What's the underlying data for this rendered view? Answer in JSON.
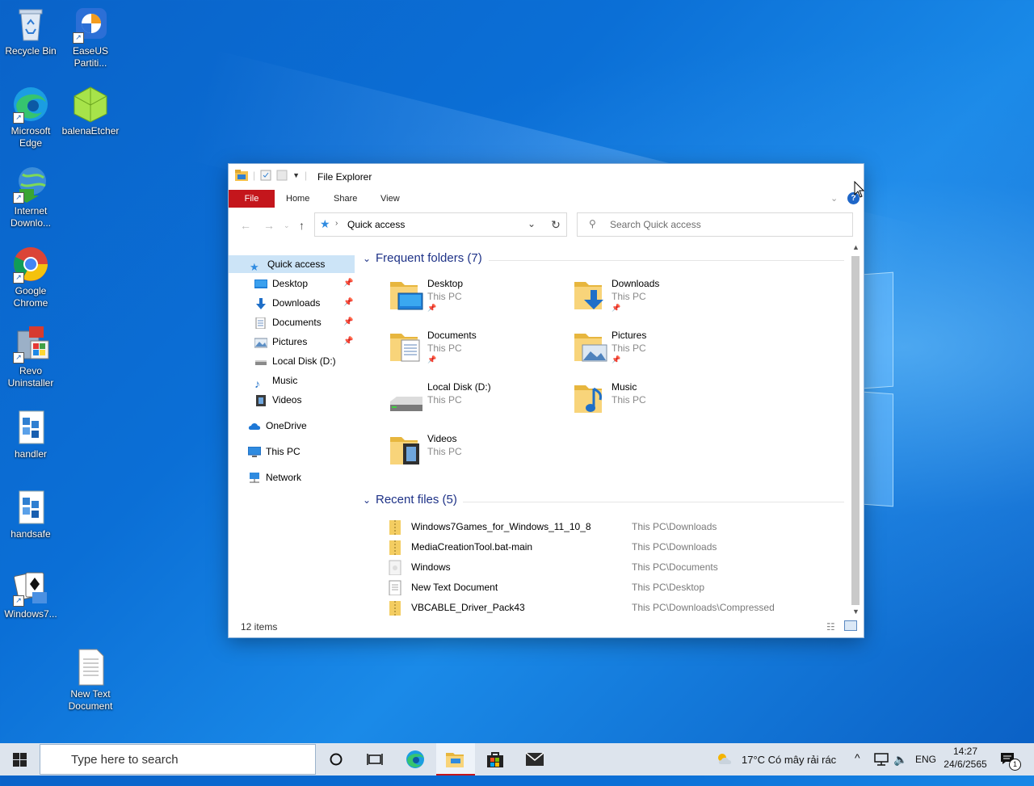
{
  "desktop": {
    "icons": [
      {
        "label": "Recycle Bin"
      },
      {
        "label": "EaseUS Partiti..."
      },
      {
        "label": "Microsoft Edge"
      },
      {
        "label": "balenaEtcher"
      },
      {
        "label": "Internet Downlo..."
      },
      {
        "label": "Google Chrome"
      },
      {
        "label": "Revo Uninstaller"
      },
      {
        "label": "handler"
      },
      {
        "label": "handsafe"
      },
      {
        "label": "Windows7..."
      },
      {
        "label": "New Text Document"
      }
    ]
  },
  "window": {
    "title": "File Explorer",
    "tabs": {
      "file": "File",
      "home": "Home",
      "share": "Share",
      "view": "View"
    },
    "address": {
      "location": "Quick access",
      "search_placeholder": "Search Quick access"
    },
    "nav": {
      "quick_access": "Quick access",
      "pinned": [
        "Desktop",
        "Downloads",
        "Documents",
        "Pictures"
      ],
      "others": [
        "Local Disk (D:)",
        "Music",
        "Videos"
      ],
      "onedrive": "OneDrive",
      "this_pc": "This PC",
      "network": "Network"
    },
    "frequent": {
      "heading": "Frequent folders (7)",
      "folders": [
        {
          "name": "Desktop",
          "location": "This PC",
          "pinned": true
        },
        {
          "name": "Downloads",
          "location": "This PC",
          "pinned": true
        },
        {
          "name": "Documents",
          "location": "This PC",
          "pinned": true
        },
        {
          "name": "Pictures",
          "location": "This PC",
          "pinned": true
        },
        {
          "name": "Local Disk (D:)",
          "location": "This PC",
          "pinned": false
        },
        {
          "name": "Music",
          "location": "This PC",
          "pinned": false
        },
        {
          "name": "Videos",
          "location": "This PC",
          "pinned": false
        }
      ]
    },
    "recent": {
      "heading": "Recent files (5)",
      "files": [
        {
          "name": "Windows7Games_for_Windows_11_10_8",
          "path": "This PC\\Downloads"
        },
        {
          "name": "MediaCreationTool.bat-main",
          "path": "This PC\\Downloads"
        },
        {
          "name": "Windows",
          "path": "This PC\\Documents"
        },
        {
          "name": "New Text Document",
          "path": "This PC\\Desktop"
        },
        {
          "name": "VBCABLE_Driver_Pack43",
          "path": "This PC\\Downloads\\Compressed"
        }
      ]
    },
    "status": "12 items"
  },
  "taskbar": {
    "search_placeholder": "Type here to search",
    "weather": "17°C  Có mây rải rác",
    "language": "ENG",
    "time": "14:27",
    "date": "24/6/2565",
    "notification_count": "1"
  }
}
